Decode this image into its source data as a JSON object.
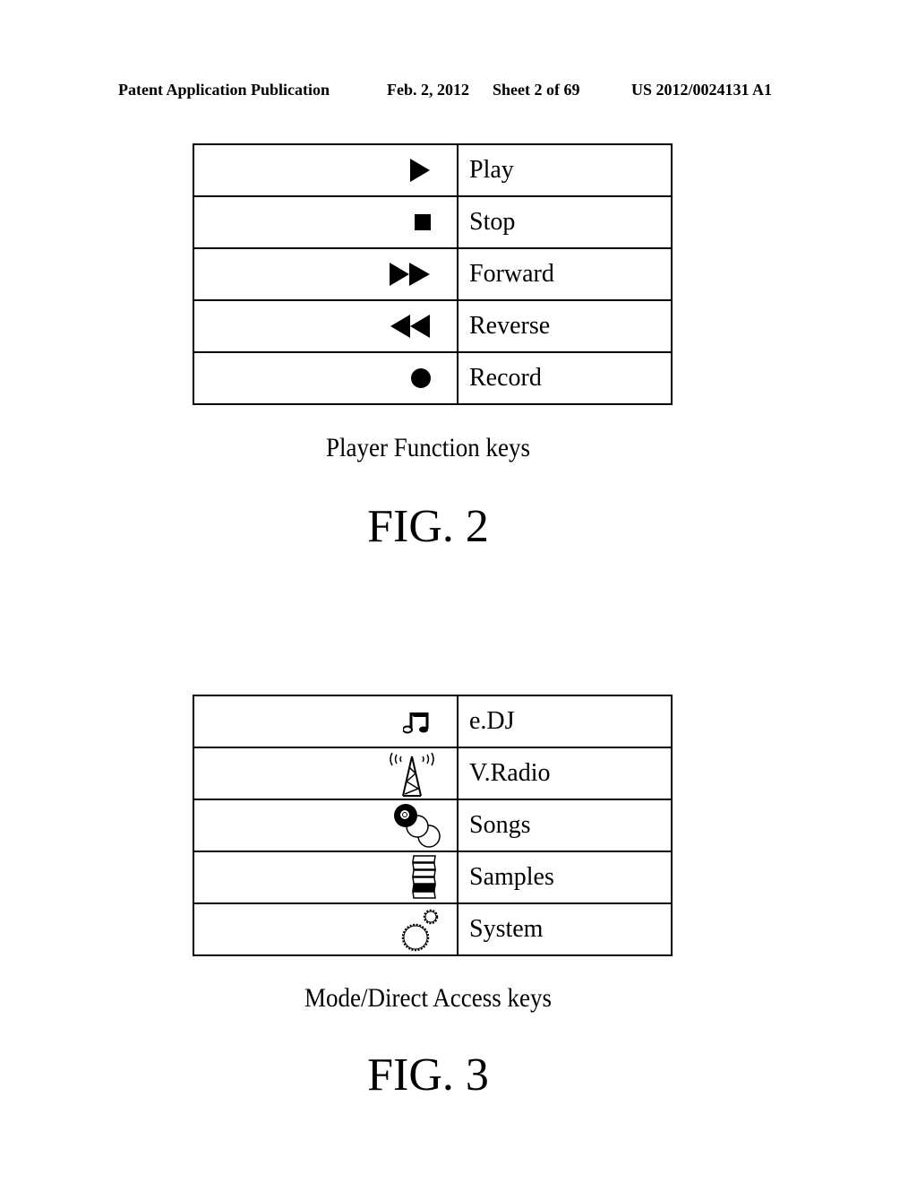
{
  "header": {
    "publication": "Patent Application Publication",
    "date": "Feb. 2, 2012",
    "sheet": "Sheet 2 of 69",
    "number": "US 2012/0024131 A1"
  },
  "fig2": {
    "rows": [
      {
        "icon": "play-icon",
        "label": "Play"
      },
      {
        "icon": "stop-icon",
        "label": "Stop"
      },
      {
        "icon": "fast-forward-icon",
        "label": "Forward"
      },
      {
        "icon": "rewind-icon",
        "label": "Reverse"
      },
      {
        "icon": "record-icon",
        "label": "Record"
      }
    ],
    "caption": "Player Function keys",
    "title": "FIG. 2"
  },
  "fig3": {
    "rows": [
      {
        "icon": "music-note-icon",
        "label": "e.DJ"
      },
      {
        "icon": "radio-tower-icon",
        "label": "V.Radio"
      },
      {
        "icon": "discs-icon",
        "label": "Songs"
      },
      {
        "icon": "stacked-samples-icon",
        "label": "Samples"
      },
      {
        "icon": "gears-icon",
        "label": "System"
      }
    ],
    "caption": "Mode/Direct Access keys",
    "title": "FIG. 3"
  }
}
